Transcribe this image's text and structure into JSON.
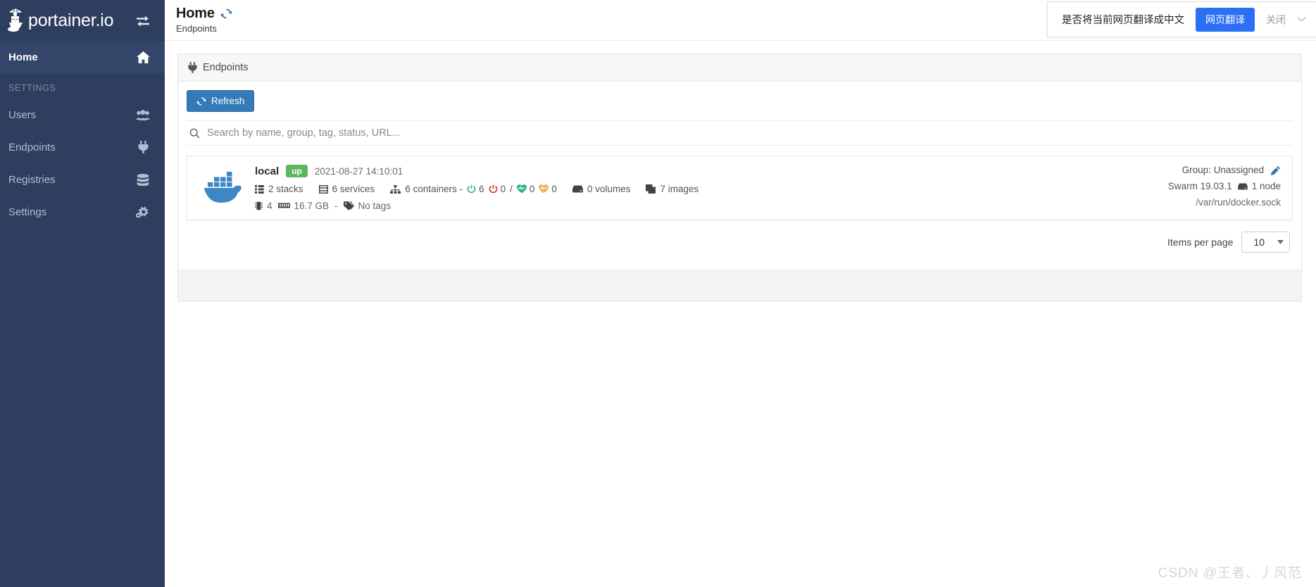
{
  "sidebar": {
    "brand": "portainer.io",
    "toggle_icon": "exchange-arrows-icon",
    "items": [
      {
        "label": "Home",
        "icon": "home-icon",
        "active": true
      }
    ],
    "section_label": "SETTINGS",
    "settings_items": [
      {
        "label": "Users",
        "icon": "users-icon"
      },
      {
        "label": "Endpoints",
        "icon": "plug-icon"
      },
      {
        "label": "Registries",
        "icon": "database-icon"
      },
      {
        "label": "Settings",
        "icon": "gears-icon"
      }
    ]
  },
  "header": {
    "title": "Home",
    "refresh_icon": "refresh-icon",
    "subtitle": "Endpoints"
  },
  "translate_bar": {
    "message": "是否将当前网页翻译成中文",
    "primary_button": "网页翻译",
    "close_label": "关闭",
    "chevron_icon": "chevron-down-icon",
    "primary_color": "#2b6ff5"
  },
  "panel": {
    "title": "Endpoints",
    "title_icon": "plug-icon",
    "refresh_button": "Refresh",
    "refresh_icon": "refresh-icon",
    "refresh_color": "#337ab7"
  },
  "search": {
    "placeholder": "Search by name, group, tag, status, URL...",
    "value": "",
    "icon": "search-icon"
  },
  "endpoint": {
    "logo_icon": "docker-whale-icon",
    "name": "local",
    "status": "up",
    "status_color": "#5cb85c",
    "timestamp": "2021-08-27 14:10:01",
    "stacks": "2 stacks",
    "stacks_icon": "list-icon",
    "services": "6 services",
    "services_icon": "server-icon",
    "containers_label": "6 containers -",
    "containers_icon": "sitemap-icon",
    "containers_running": "6",
    "containers_running_icon": "power-on-icon",
    "containers_stopped": "0",
    "containers_stopped_icon": "power-off-icon",
    "separator": "/",
    "containers_healthy": "0",
    "containers_healthy_icon": "heartbeat-green-icon",
    "containers_unhealthy": "0",
    "containers_unhealthy_icon": "heartbeat-orange-icon",
    "volumes": "0 volumes",
    "volumes_icon": "hdd-icon",
    "images": "7 images",
    "images_icon": "clone-icon",
    "cpu": "4",
    "cpu_icon": "microchip-icon",
    "memory": "16.7 GB",
    "memory_icon": "memory-icon",
    "dash": "-",
    "tags": "No tags",
    "tags_icon": "tag-icon",
    "group": "Group: Unassigned",
    "edit_icon": "pencil-icon",
    "swarm": "Swarm 19.03.1",
    "nodes": "1 node",
    "nodes_icon": "hdd-icon",
    "url": "/var/run/docker.sock"
  },
  "pagination": {
    "label": "Items per page",
    "value": "10",
    "caret_icon": "caret-down-icon"
  },
  "watermark": "CSDN @王者、丿风范"
}
